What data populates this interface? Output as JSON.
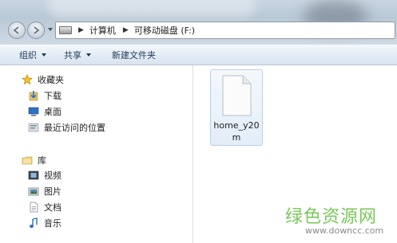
{
  "address": {
    "drive_icon": "drive-icon",
    "segments": [
      "计算机",
      "可移动磁盘 (F:)"
    ]
  },
  "toolbar": {
    "organize_label": "组织",
    "share_label": "共享",
    "new_folder_label": "新建文件夹"
  },
  "nav": {
    "favorites": {
      "label": "收藏夹",
      "items": [
        {
          "label": "下载",
          "icon": "downloads-icon"
        },
        {
          "label": "桌面",
          "icon": "desktop-icon"
        },
        {
          "label": "最近访问的位置",
          "icon": "recent-places-icon"
        }
      ]
    },
    "libraries": {
      "label": "库",
      "items": [
        {
          "label": "视频",
          "icon": "videos-icon"
        },
        {
          "label": "图片",
          "icon": "pictures-icon"
        },
        {
          "label": "文档",
          "icon": "documents-icon"
        },
        {
          "label": "音乐",
          "icon": "music-icon"
        }
      ]
    }
  },
  "files": [
    {
      "name": "home_y20m",
      "icon": "generic-file-icon"
    }
  ],
  "watermark": {
    "title": "绿色资源网",
    "url": "www.downcc.com"
  }
}
